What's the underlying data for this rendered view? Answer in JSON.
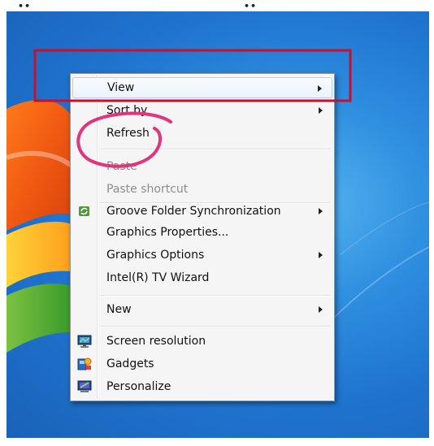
{
  "top_marks": [
    "••",
    "••"
  ],
  "menu": {
    "items": [
      {
        "label": "View",
        "submenu": true
      },
      {
        "label": "Sort by",
        "submenu": true
      },
      {
        "label": "Refresh",
        "submenu": false
      },
      {
        "label": "Paste",
        "disabled": true
      },
      {
        "label": "Paste shortcut",
        "disabled": true
      },
      {
        "label": "Groove Folder Synchronization",
        "submenu": true,
        "icon": "groove-sync-icon"
      },
      {
        "label": "Graphics Properties...",
        "submenu": false
      },
      {
        "label": "Graphics Options",
        "submenu": true
      },
      {
        "label": "Intel(R) TV Wizard",
        "submenu": false
      },
      {
        "label": "New",
        "submenu": true
      },
      {
        "label": "Screen resolution",
        "icon": "display-icon"
      },
      {
        "label": "Gadgets",
        "icon": "gadgets-icon"
      },
      {
        "label": "Personalize",
        "icon": "personalize-icon"
      }
    ]
  },
  "colors": {
    "annotation_box": "#c8102e",
    "annotation_circle": "#e0357a",
    "menu_highlight": "#aecff7"
  }
}
